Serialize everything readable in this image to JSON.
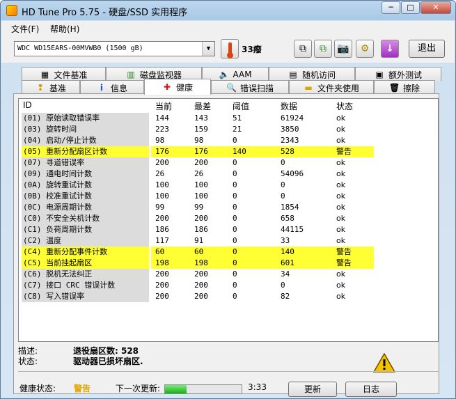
{
  "window": {
    "title": "HD Tune Pro 5.75 - 硬盘/SSD 实用程序"
  },
  "menu": [
    "文件(F)",
    "帮助(H)"
  ],
  "toolbar": {
    "drive": "WDC WD15EARS-00MVWB0 (1500 gB)",
    "temperature": "33癈",
    "exit_label": "退出",
    "icons": [
      "copy-info-icon",
      "copy-report-icon",
      "screenshot-icon",
      "options-icon",
      "save-icon"
    ]
  },
  "tabs_top": [
    "文件基准",
    "磁盘监视器",
    "AAM",
    "随机访问",
    "额外测试"
  ],
  "tabs_bottom": [
    "基准",
    "信息",
    "健康",
    "错误扫描",
    "文件夹使用",
    "擦除"
  ],
  "active_tab": "健康",
  "table": {
    "headers": [
      "ID",
      "当前",
      "最差",
      "阈值",
      "数据",
      "状态"
    ],
    "rows": [
      {
        "id": "(01) 原始读取错误率",
        "current": "144",
        "worst": "143",
        "threshold": "51",
        "data": "61924",
        "status": "ok",
        "warn": false
      },
      {
        "id": "(03) 旋转时间",
        "current": "223",
        "worst": "159",
        "threshold": "21",
        "data": "3850",
        "status": "ok",
        "warn": false
      },
      {
        "id": "(04) 启动/停止计数",
        "current": "98",
        "worst": "98",
        "threshold": "0",
        "data": "2343",
        "status": "ok",
        "warn": false
      },
      {
        "id": "(05) 重新分配扇区计数",
        "current": "176",
        "worst": "176",
        "threshold": "140",
        "data": "528",
        "status": "警告",
        "warn": true
      },
      {
        "id": "(07) 寻道错误率",
        "current": "200",
        "worst": "200",
        "threshold": "0",
        "data": "0",
        "status": "ok",
        "warn": false
      },
      {
        "id": "(09) 通电时间计数",
        "current": "26",
        "worst": "26",
        "threshold": "0",
        "data": "54096",
        "status": "ok",
        "warn": false
      },
      {
        "id": "(0A) 旋转重试计数",
        "current": "100",
        "worst": "100",
        "threshold": "0",
        "data": "0",
        "status": "ok",
        "warn": false
      },
      {
        "id": "(0B) 校准重试计数",
        "current": "100",
        "worst": "100",
        "threshold": "0",
        "data": "0",
        "status": "ok",
        "warn": false
      },
      {
        "id": "(0C) 电源周期计数",
        "current": "99",
        "worst": "99",
        "threshold": "0",
        "data": "1854",
        "status": "ok",
        "warn": false
      },
      {
        "id": "(C0) 不安全关机计数",
        "current": "200",
        "worst": "200",
        "threshold": "0",
        "data": "658",
        "status": "ok",
        "warn": false
      },
      {
        "id": "(C1) 负荷周期计数",
        "current": "186",
        "worst": "186",
        "threshold": "0",
        "data": "44115",
        "status": "ok",
        "warn": false
      },
      {
        "id": "(C2) 温度",
        "current": "117",
        "worst": "91",
        "threshold": "0",
        "data": "33",
        "status": "ok",
        "warn": false
      },
      {
        "id": "(C4) 重新分配事件计数",
        "current": "60",
        "worst": "60",
        "threshold": "0",
        "data": "140",
        "status": "警告",
        "warn": true
      },
      {
        "id": "(C5) 当前挂起扇区",
        "current": "198",
        "worst": "198",
        "threshold": "0",
        "data": "601",
        "status": "警告",
        "warn": true
      },
      {
        "id": "(C6) 脱机无法纠正",
        "current": "200",
        "worst": "200",
        "threshold": "0",
        "data": "34",
        "status": "ok",
        "warn": false
      },
      {
        "id": "(C7) 接口 CRC 错误计数",
        "current": "200",
        "worst": "200",
        "threshold": "0",
        "data": "0",
        "status": "ok",
        "warn": false
      },
      {
        "id": "(C8) 写入错误率",
        "current": "200",
        "worst": "200",
        "threshold": "0",
        "data": "82",
        "status": "ok",
        "warn": false
      }
    ]
  },
  "description": {
    "desc_label": "描述:",
    "desc_value": "退役扇区数: 528",
    "status_label": "状态:",
    "status_value": "驱动器已损坏扇区."
  },
  "statusbar": {
    "health_label": "健康状态:",
    "health_value": "警告",
    "health_color": "#e0a800",
    "next_update_label": "下一次更新:",
    "progress": 0.28,
    "countdown": "3:33",
    "refresh_label": "更新",
    "log_label": "日志"
  }
}
